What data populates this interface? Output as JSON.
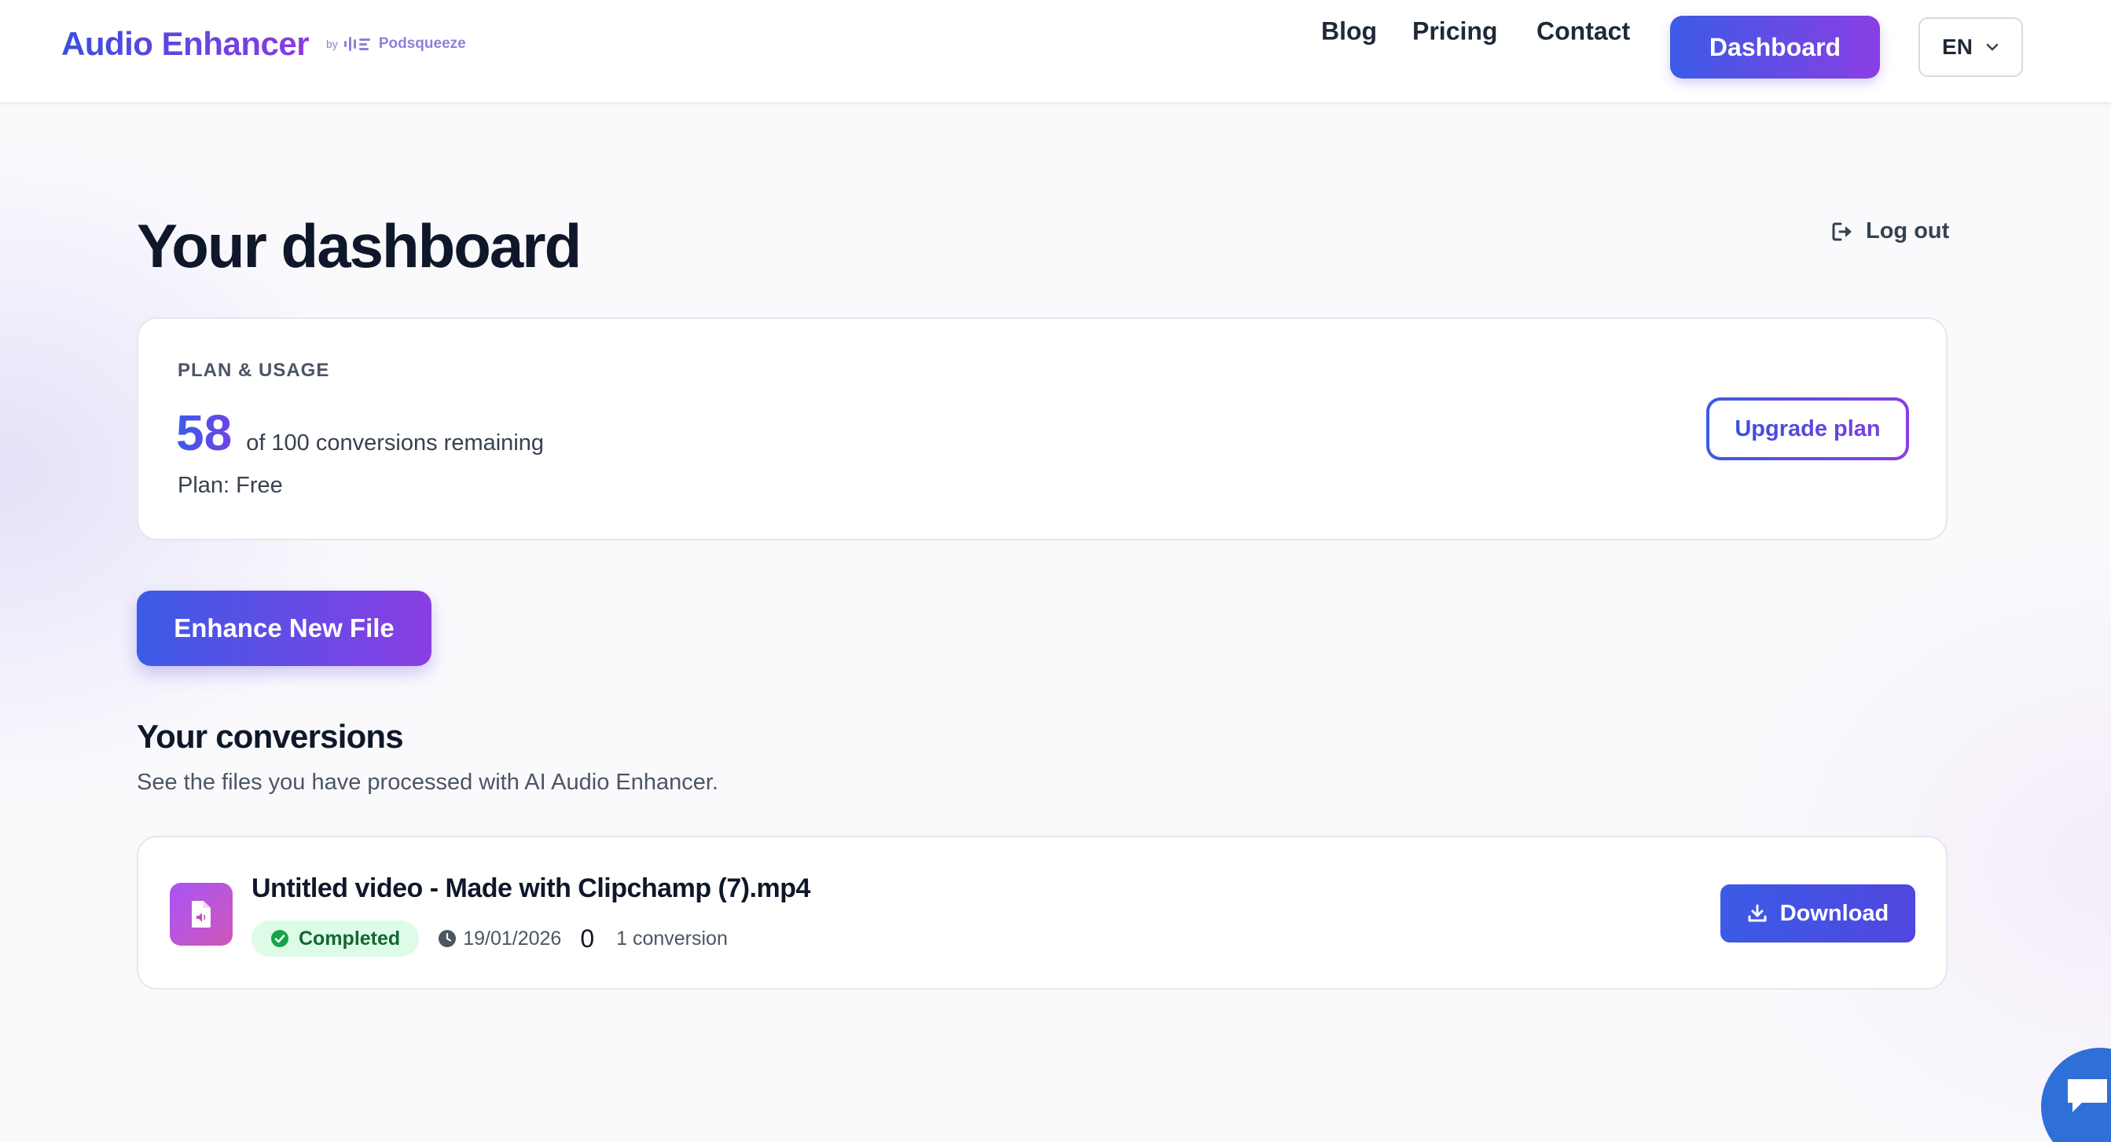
{
  "header": {
    "logo_text": "Audio Enhancer",
    "logo_by": "by",
    "logo_brand": "Podsqueeze",
    "nav": [
      {
        "label": "Blog"
      },
      {
        "label": "Pricing"
      },
      {
        "label": "Contact"
      }
    ],
    "dashboard_label": "Dashboard",
    "language": "EN"
  },
  "main": {
    "title": "Your dashboard",
    "logout_label": "Log out",
    "plan": {
      "section_label": "PLAN & USAGE",
      "remaining": "58",
      "remaining_text": "of 100 conversions remaining",
      "plan_text": "Plan: Free",
      "upgrade_label": "Upgrade plan"
    },
    "enhance_label": "Enhance New File",
    "conversions": {
      "title": "Your conversions",
      "subtitle": "See the files you have processed with AI Audio Enhancer.",
      "items": [
        {
          "file_name": "Untitled video - Made with Clipchamp (7).mp4",
          "status": "Completed",
          "date": "19/01/2026",
          "counter": "0",
          "conversion_count": "1 conversion",
          "download_label": "Download"
        }
      ]
    }
  },
  "colors": {
    "accent_start": "#3b5be6",
    "accent_end": "#8a3ee3",
    "status_completed_bg": "#dcfce7",
    "status_completed_text": "#166534",
    "chat_bubble": "#2f6fd8"
  },
  "icons": {
    "logout": "logout-icon",
    "chevron": "chevron-down-icon",
    "file": "audio-file-icon",
    "status": "check-circle-icon",
    "date": "clock-icon",
    "download": "download-icon",
    "chat": "chat-icon"
  }
}
